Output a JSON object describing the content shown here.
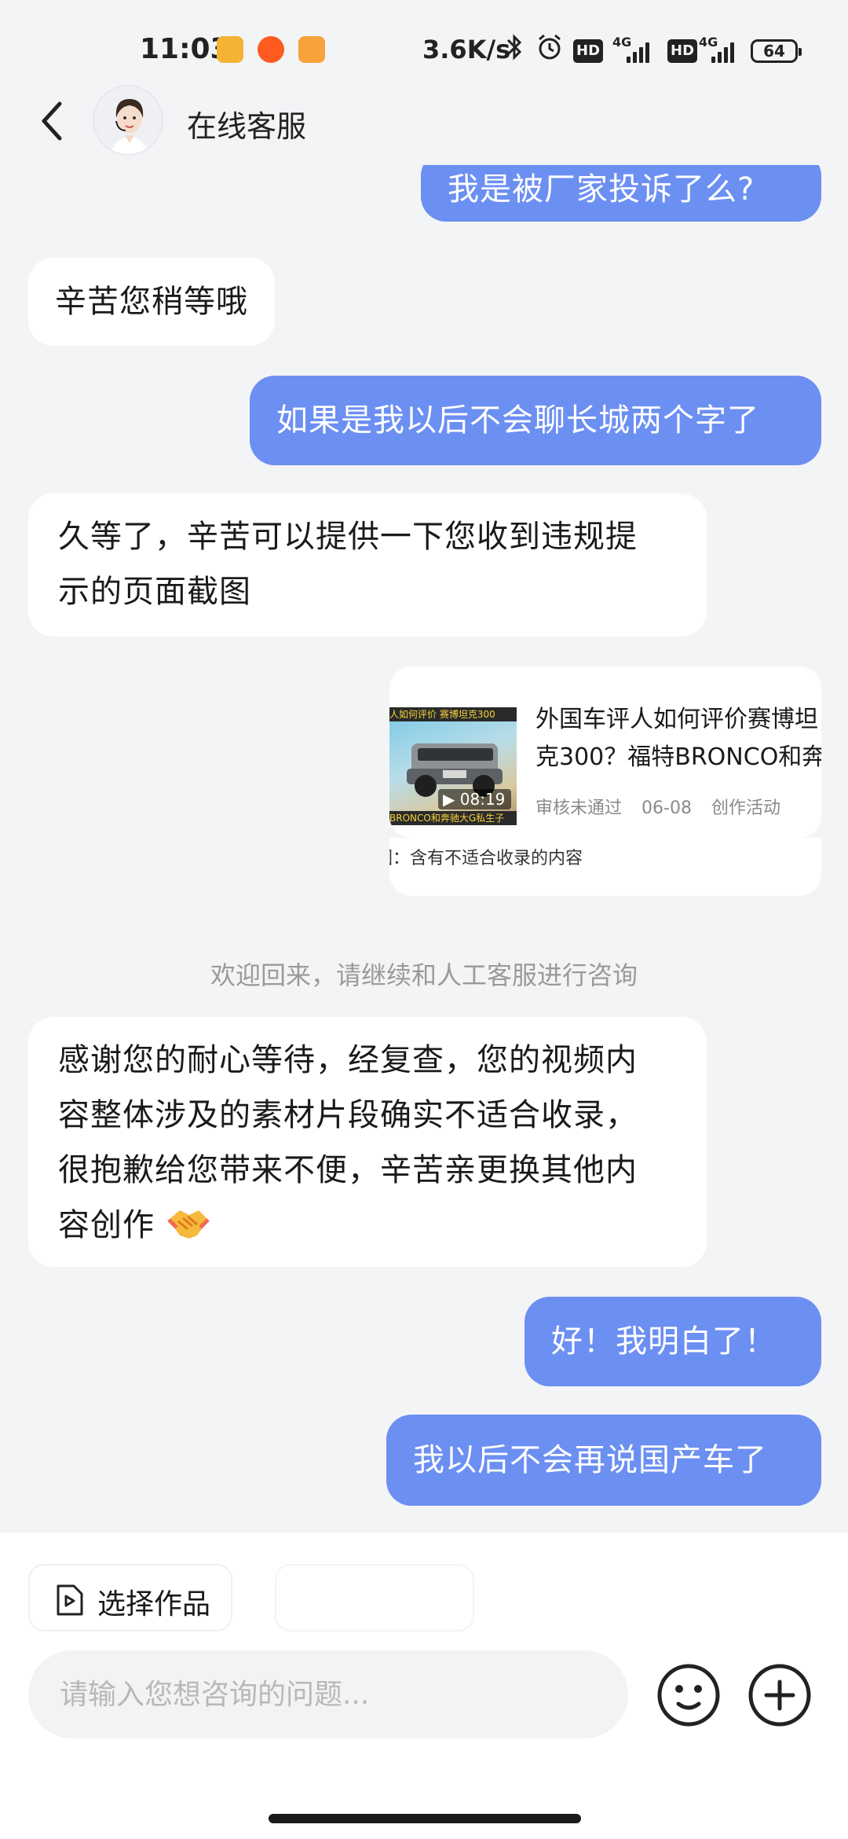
{
  "status_bar": {
    "time": "11:03",
    "net_speed": "3.6K/s",
    "hd_label": "HD",
    "network_type": "4G",
    "battery": "64"
  },
  "header": {
    "title": "在线客服"
  },
  "messages": [
    {
      "id": "m1",
      "side": "out",
      "text": "我是被厂家投诉了么?"
    },
    {
      "id": "m2",
      "side": "in",
      "text": "辛苦您稍等哦"
    },
    {
      "id": "m3",
      "side": "out",
      "text": "如果是我以后不会聊长城两个字了"
    },
    {
      "id": "m4",
      "side": "in",
      "lines": [
        "久等了，辛苦可以提供一下您收到违规提",
        "示的页面截图"
      ]
    },
    {
      "id": "m6",
      "side": "in",
      "lines": [
        "感谢您的耐心等待，经复查，您的视频内",
        "容整体涉及的素材片段确实不适合收录，",
        "很抱歉给您带来不便，辛苦亲更换其他内",
        "容创作"
      ],
      "emoji": "handshake-emoji"
    },
    {
      "id": "m7",
      "side": "out",
      "text": "好！我明白了！"
    },
    {
      "id": "m8",
      "side": "out",
      "text": "我以后不会再说国产车了"
    }
  ],
  "shared_card": {
    "thumb_top_text": "人如何评价 赛博坦克300",
    "thumb_bottom_text": "BRONCO和奔驰大G私生子",
    "duration": "08:19",
    "title_line1": "外国车评人如何评价赛博坦",
    "title_line2": "克300？福特BRONCO和奔",
    "status": "审核未通过",
    "date": "06-08",
    "category": "创作活动",
    "reason": "因：含有不适合收录的内容"
  },
  "system_notice": "欢迎回来，请继续和人工客服进行咨询",
  "bottom": {
    "select_work_label": "选择作品",
    "input_placeholder": "请输入您想咨询的问题...",
    "emoji_icon": "smiley-icon",
    "plus_icon": "plus-icon"
  },
  "colors": {
    "outgoing_bubble": "#6c8ff2",
    "incoming_bubble": "#ffffff",
    "background": "#f3f4f6"
  }
}
